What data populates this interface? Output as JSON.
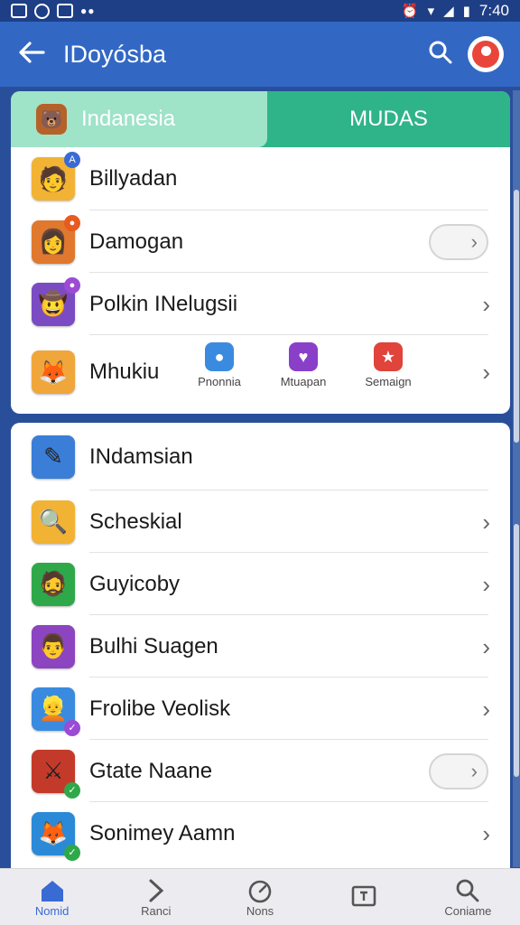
{
  "status_bar": {
    "time": "7:40"
  },
  "app_bar": {
    "title": "IDoyósba"
  },
  "tabs": [
    {
      "label": "Indanesia",
      "active": true
    },
    {
      "label": "MUDAS",
      "active": false
    }
  ],
  "section1": [
    {
      "label": "Billyadan",
      "icon": "character-icon",
      "color": "#f2b233",
      "trailing": "none"
    },
    {
      "label": "Damogan",
      "icon": "character-icon",
      "color": "#e0782e",
      "trailing": "toggle"
    },
    {
      "label": "Polkin INelugsii",
      "icon": "character-icon",
      "color": "#7b4bc4",
      "trailing": "chevron"
    },
    {
      "label": "Mhukiu",
      "icon": "character-icon",
      "color": "#f0a63a",
      "trailing": "chevron"
    }
  ],
  "mini_items": [
    {
      "label": "Pnonnia",
      "color": "#3a8be0"
    },
    {
      "label": "Mtuapan",
      "color": "#8a3fc8"
    },
    {
      "label": "Semaign",
      "color": "#e0443a"
    }
  ],
  "section2": [
    {
      "label": "INdamsian",
      "color": "#3a7ed8",
      "trailing": "none"
    },
    {
      "label": "Scheskial",
      "color": "#f2b233",
      "trailing": "chevron"
    },
    {
      "label": "Guyicoby",
      "color": "#2fa84a",
      "trailing": "chevron"
    },
    {
      "label": "Bulhi Suagen",
      "color": "#8c44c0",
      "trailing": "chevron"
    },
    {
      "label": "Frolibe Veolisk",
      "color": "#3a8be0",
      "trailing": "chevron"
    },
    {
      "label": "Gtate Naane",
      "color": "#c43a2a",
      "trailing": "toggle"
    },
    {
      "label": "Sonimey Aamn",
      "color": "#2a8ad8",
      "trailing": "chevron"
    }
  ],
  "bottom_nav": [
    {
      "label": "Nomid",
      "active": true
    },
    {
      "label": "Ranci",
      "active": false
    },
    {
      "label": "Nons",
      "active": false
    },
    {
      "label": "",
      "active": false
    },
    {
      "label": "Coniame",
      "active": false
    }
  ]
}
